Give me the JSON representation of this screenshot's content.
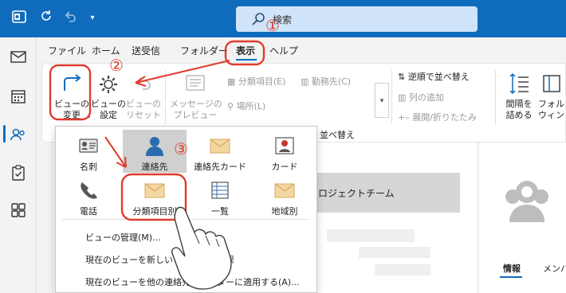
{
  "titlebar": {
    "search_placeholder": "検索"
  },
  "tabs": [
    {
      "label": "ファイル"
    },
    {
      "label": "ホーム"
    },
    {
      "label": "送受信"
    },
    {
      "label": "フォルダー"
    },
    {
      "label": "表示"
    },
    {
      "label": "ヘルプ"
    }
  ],
  "ribbon": {
    "change_view": "ビューの\n変更",
    "view_settings": "ビューの\n設定",
    "view_reset": "ビューの\nリセット",
    "message_preview": "メッセージの\nプレビュー",
    "category_item": "分類項目(E)",
    "company": "勤務先(C)",
    "location": "場所(L)",
    "reverse_sort": "逆順で並べ替え",
    "add_column": "列の追加",
    "expand_collapse": "展開/折りたたみ",
    "sort_group_label": "並べ替え",
    "spacing": "間隔を\n詰める",
    "folder_window": "フォル\nウィンド"
  },
  "dropdown": {
    "items": [
      {
        "label": "名刺",
        "icon": "business-card-icon"
      },
      {
        "label": "連絡先",
        "icon": "person-icon"
      },
      {
        "label": "連絡先カード",
        "icon": "envelope-icon"
      },
      {
        "label": "カード",
        "icon": "contact-card-icon"
      },
      {
        "label": "電話",
        "icon": "phone-icon"
      },
      {
        "label": "分類項目別",
        "icon": "envelope-icon"
      },
      {
        "label": "一覧",
        "icon": "list-icon"
      },
      {
        "label": "地域別",
        "icon": "envelope-icon"
      }
    ],
    "menu": [
      {
        "label": "ビューの管理(M)..."
      },
      {
        "label": "現在のビューを新しいビューとして保"
      },
      {
        "label": "現在のビューを他の連絡先フォルダーに適用する(A)..."
      }
    ]
  },
  "main": {
    "group_title": "ロジェクトチーム"
  },
  "right_panel": {
    "tabs": [
      {
        "label": "情報"
      },
      {
        "label": "メンバー"
      }
    ]
  },
  "annotations": {
    "step1": "①",
    "step2": "②",
    "step3": "③"
  },
  "colors": {
    "brand": "#0f6cbd",
    "annotation": "#e03c2c",
    "search_bg": "#cfe4f8"
  }
}
